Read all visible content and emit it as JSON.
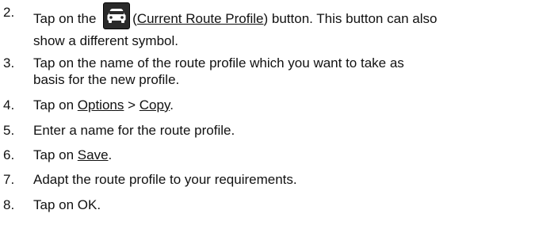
{
  "steps": [
    {
      "number": "2.",
      "pre": "Tap on the",
      "link": "Current Route Profile",
      "post": ") button. This button can also",
      "line2": "show a different symbol.",
      "icon": "car-icon"
    },
    {
      "number": "3.",
      "line1": "Tap on the name of the route profile which you want to take as",
      "line2": "basis for the new profile."
    },
    {
      "number": "4.",
      "pre": "Tap on",
      "link1": "Options",
      "sep": ">",
      "link2": "Copy",
      "end": "."
    },
    {
      "number": "5.",
      "text": "Enter a name for the route profile."
    },
    {
      "number": "6.",
      "pre": "Tap on",
      "link": "Save",
      "end": "."
    },
    {
      "number": "7.",
      "text": "Adapt the route profile to your requirements."
    },
    {
      "number": "8.",
      "text": "Tap on OK."
    }
  ]
}
